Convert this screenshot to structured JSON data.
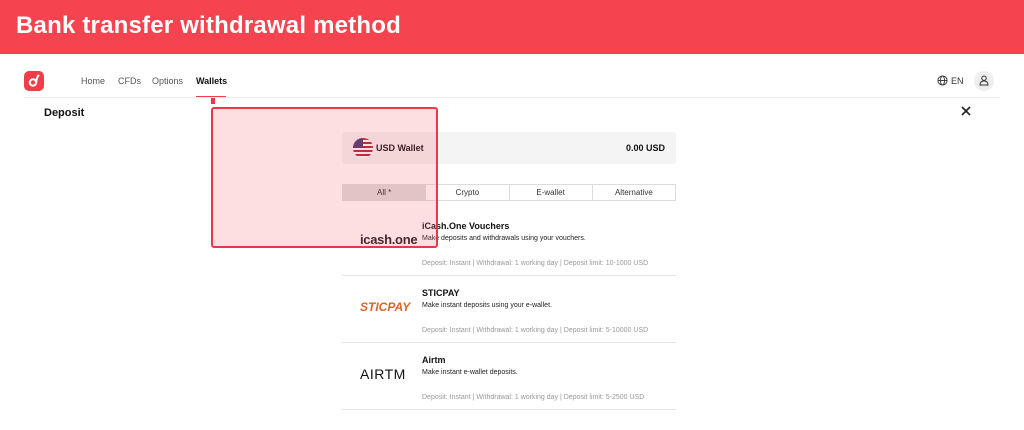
{
  "banner": {
    "title": "Bank transfer withdrawal method"
  },
  "nav": {
    "items": [
      {
        "label": "Home"
      },
      {
        "label": "CFDs"
      },
      {
        "label": "Options"
      },
      {
        "label": "Wallets",
        "active": true
      }
    ],
    "language": "EN",
    "icons": {
      "logo": "brand-logo-icon",
      "globe": "globe-icon",
      "user": "user-icon"
    }
  },
  "deposit": {
    "title": "Deposit",
    "close_icon": "close-icon"
  },
  "wallet": {
    "name": "USD Wallet",
    "balance": "0.00 USD",
    "flag_icon": "us-flag-icon"
  },
  "tabs": [
    {
      "label": "All *",
      "selected": true
    },
    {
      "label": "Crypto"
    },
    {
      "label": "E-wallet"
    },
    {
      "label": "Alternative"
    }
  ],
  "methods": [
    {
      "logo_text": "icash.one",
      "name": "iCash.One Vouchers",
      "description": "Make deposits and withdrawals using your vouchers.",
      "info": "Deposit: Instant | Withdrawal: 1 working day | Deposit limit: 10-1000 USD"
    },
    {
      "logo_text": "STICPAY",
      "name": "STICPAY",
      "description": "Make instant deposits using your e-wallet.",
      "info": "Deposit: Instant | Withdrawal: 1 working day | Deposit limit: 5-10000 USD"
    },
    {
      "logo_text": "AIRTM",
      "name": "Airtm",
      "description": "Make instant e-wallet deposits.",
      "info": "Deposit: Instant | Withdrawal: 1 working day | Deposit limit: 5-2500 USD"
    }
  ],
  "colors": {
    "brand": "#f03e48",
    "banner": "#f5434f",
    "highlight": "#e8394a",
    "sticpay": "#d8662a"
  }
}
